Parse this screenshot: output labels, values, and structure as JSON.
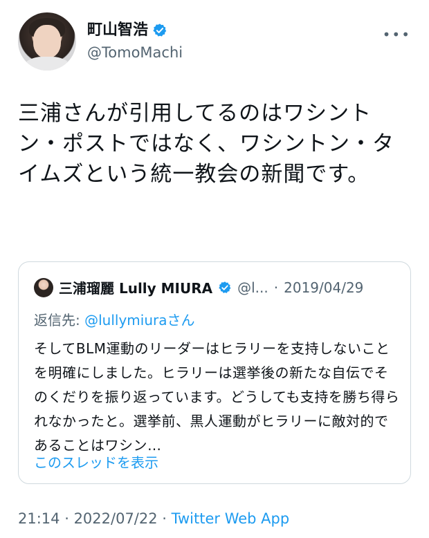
{
  "author": {
    "display_name": "町山智浩",
    "handle": "@TomoMachi"
  },
  "more_label": "•••",
  "tweet": {
    "text": "三浦さんが引用してるのはワシントン・ポストではなく、ワシントン・タイムズという統一教会の新聞です。"
  },
  "quoted": {
    "display_name": "三浦瑠麗 Lully MIURA",
    "handle_truncated": "@l...",
    "separator": "·",
    "date": "2019/04/29",
    "replying_prefix": "返信先: ",
    "replying_to": "@lullymiura",
    "replying_suffix": "さん",
    "text": "そしてBLM運動のリーダーはヒラリーを支持しないことを明確にしました。ヒラリーは選挙後の新たな自伝でそのくだりを振り返っています。どうしても支持を勝ち得られなかったと。選挙前、黒人運動がヒラリーに敵対的であることはワシン…",
    "show_thread": "このスレッドを表示"
  },
  "meta": {
    "time": "21:14",
    "separator1": " · ",
    "date": "2022/07/22",
    "separator2": " · ",
    "app": "Twitter Web App"
  },
  "colors": {
    "link": "#1d9bf0",
    "secondary_text": "#536471",
    "border": "#cfd9de",
    "verified": "#1d9bf0"
  },
  "icons": {
    "verified": "verified-badge-icon",
    "more": "more-dots-icon"
  }
}
